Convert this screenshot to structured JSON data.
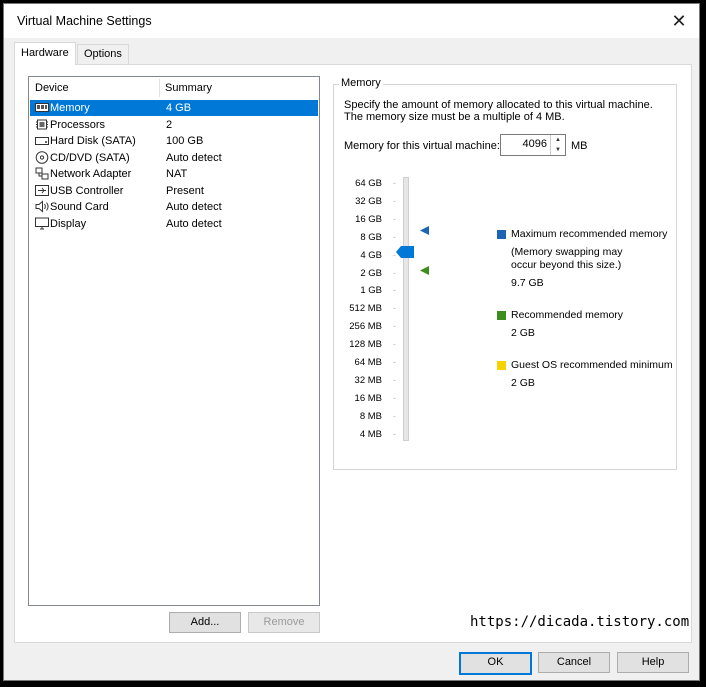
{
  "window": {
    "title": "Virtual Machine Settings",
    "close_glyph": "✕"
  },
  "tabs": [
    {
      "label": "Hardware",
      "active": true
    },
    {
      "label": "Options",
      "active": false
    }
  ],
  "devices": {
    "headers": {
      "device": "Device",
      "summary": "Summary"
    },
    "rows": [
      {
        "name": "Memory",
        "summary": "4 GB",
        "icon": "memory-icon",
        "selected": true
      },
      {
        "name": "Processors",
        "summary": "2",
        "icon": "processor-icon"
      },
      {
        "name": "Hard Disk (SATA)",
        "summary": "100 GB",
        "icon": "hard-disk-icon"
      },
      {
        "name": "CD/DVD (SATA)",
        "summary": "Auto detect",
        "icon": "cd-dvd-icon"
      },
      {
        "name": "Network Adapter",
        "summary": "NAT",
        "icon": "network-adapter-icon"
      },
      {
        "name": "USB Controller",
        "summary": "Present",
        "icon": "usb-icon"
      },
      {
        "name": "Sound Card",
        "summary": "Auto detect",
        "icon": "speaker-icon"
      },
      {
        "name": "Display",
        "summary": "Auto detect",
        "icon": "monitor-icon"
      }
    ]
  },
  "device_buttons": {
    "add": "Add...",
    "remove": "Remove"
  },
  "memory": {
    "group_label": "Memory",
    "description": "Specify the amount of memory allocated to this virtual machine. The memory size must be a multiple of 4 MB.",
    "field_label": "Memory for this virtual machine:",
    "value": "4096",
    "unit": "MB",
    "scale": [
      "64 GB",
      "32 GB",
      "16 GB",
      "8 GB",
      "4 GB",
      "2 GB",
      "1 GB",
      "512 MB",
      "256 MB",
      "128 MB",
      "64 MB",
      "32 MB",
      "16 MB",
      "8 MB",
      "4 MB"
    ],
    "current_level": "4 GB",
    "legend": {
      "max": {
        "label": "Maximum recommended memory",
        "note": "(Memory swapping may occur beyond this size.)",
        "value": "9.7 GB",
        "color": "#1e64b4"
      },
      "recommended": {
        "label": "Recommended memory",
        "value": "2 GB",
        "color": "#3c8c1e"
      },
      "guest_min": {
        "label": "Guest OS recommended minimum",
        "value": "2 GB",
        "color": "#f5d200"
      }
    }
  },
  "footer": {
    "ok": "OK",
    "cancel": "Cancel",
    "help": "Help"
  },
  "watermark": "https://dicada.tistory.com",
  "colors": {
    "selection": "#0078d7",
    "slider_thumb": "#0078d7"
  }
}
